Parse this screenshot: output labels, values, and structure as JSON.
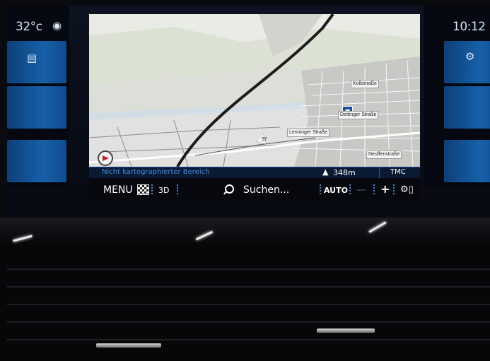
{
  "status": {
    "temperature": "32°c",
    "clock": "10:12"
  },
  "side_icons": {
    "left": "window-stack-icon",
    "right": "settings-gears-icon",
    "location": "location-pin-icon"
  },
  "map": {
    "streets": {
      "kolbstrasse": "Kolbstraße",
      "dettinger": "Dettinger Straße",
      "lenninger": "Lenninger Straße",
      "neuffen": "Neuffenstraße",
      "route_number": "97"
    },
    "info_bar": {
      "status": "Nicht kartographierter Bereich",
      "distance": "348m",
      "traffic": "TMC"
    }
  },
  "toolbar": {
    "menu": "MENU",
    "view": "3D",
    "search": "Suchen...",
    "zoom_mode": "AUTO",
    "zoom_out": "—",
    "zoom_in": "+"
  },
  "colors": {
    "accent": "#3f8be0",
    "tile_blue": "#1660a8",
    "route": "#1c1c1c",
    "water": "#cfe2f3"
  }
}
